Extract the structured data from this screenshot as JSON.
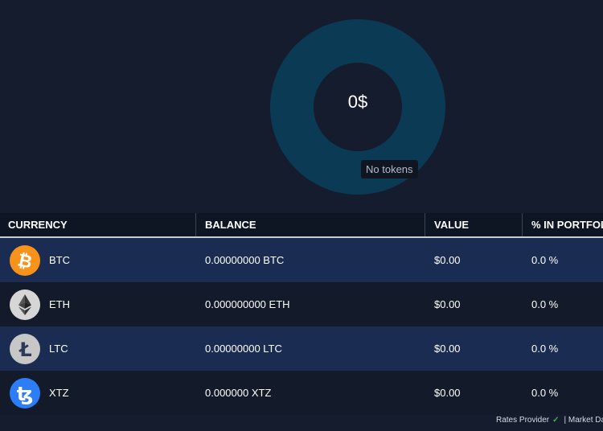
{
  "portfolio": {
    "total": "0$",
    "tooltip": "No tokens",
    "colors": {
      "ring": "#0b3a55",
      "hole": "#141c2d",
      "background": "#141c2d"
    }
  },
  "table": {
    "headers": [
      "CURRENCY",
      "BALANCE",
      "VALUE",
      "% IN PORTFOLIO"
    ],
    "rows": [
      {
        "symbol": "BTC",
        "icon": "bitcoin-icon",
        "color": "#f7931a",
        "balance": "0.00000000 BTC",
        "value": "$0.00",
        "percent": "0.0 %"
      },
      {
        "symbol": "ETH",
        "icon": "ethereum-icon",
        "color": "#d6d6d6",
        "balance": "0.000000000 ETH",
        "value": "$0.00",
        "percent": "0.0 %"
      },
      {
        "symbol": "LTC",
        "icon": "litecoin-icon",
        "color": "#c7c7c7",
        "balance": "0.00000000 LTC",
        "value": "$0.00",
        "percent": "0.0 %"
      },
      {
        "symbol": "XTZ",
        "icon": "tezos-icon",
        "color": "#2c7df7",
        "balance": "0.000000 XTZ",
        "value": "$0.00",
        "percent": "0.0 %"
      }
    ]
  },
  "footer": {
    "rates_provider": "Rates Provider",
    "market_data": "| Market Data"
  }
}
